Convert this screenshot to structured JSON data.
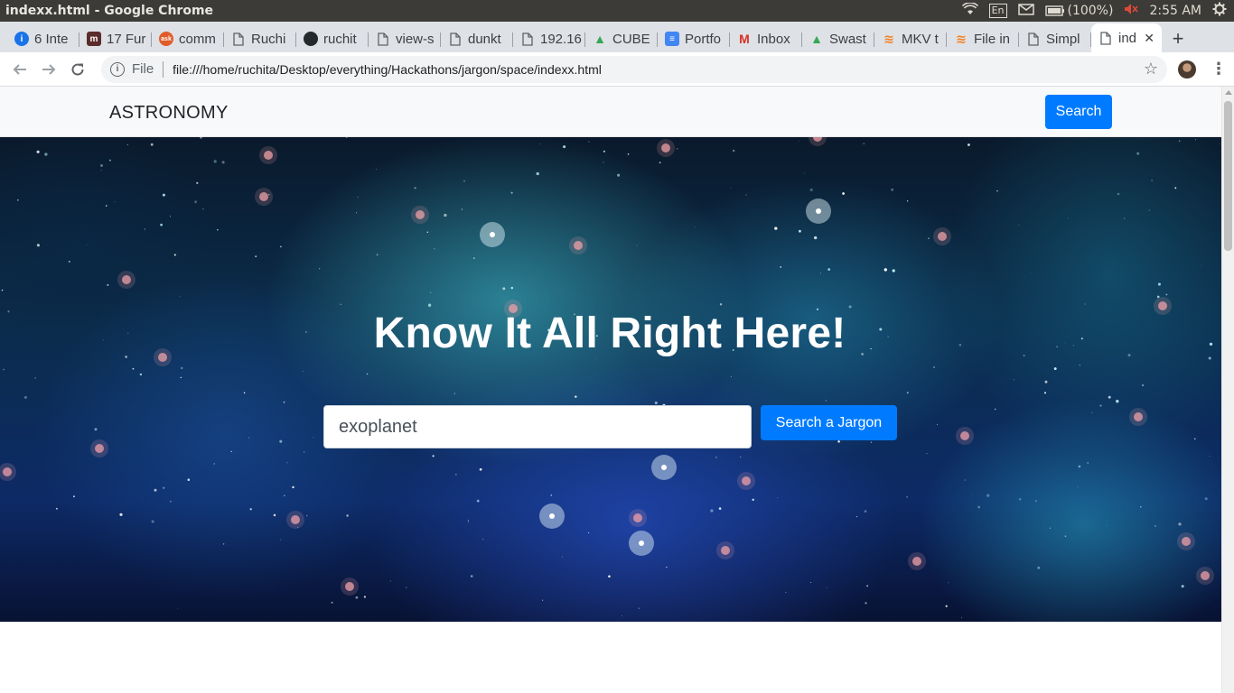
{
  "window": {
    "title": "indexx.html - Google Chrome",
    "tray": {
      "keyboard": "En",
      "battery": "(100%)",
      "clock": "2:55 AM"
    }
  },
  "tabs": [
    {
      "label": "6 Inte",
      "icon": "info-tab-icon",
      "color": "#1a73e8"
    },
    {
      "label": "17 Fur",
      "icon": "m-logo-icon",
      "color": "#5b2c2c"
    },
    {
      "label": "comm",
      "icon": "ask-logo-icon",
      "color": "#e05d2b"
    },
    {
      "label": "Ruchi",
      "icon": "page-icon",
      "color": "#5f6368"
    },
    {
      "label": "ruchit",
      "icon": "github-icon",
      "color": "#24292e"
    },
    {
      "label": "view-s",
      "icon": "page-icon",
      "color": "#5f6368"
    },
    {
      "label": "dunkt",
      "icon": "page-icon",
      "color": "#5f6368"
    },
    {
      "label": "192.16",
      "icon": "page-icon",
      "color": "#5f6368"
    },
    {
      "label": "CUBE",
      "icon": "drive-icon",
      "color": "#34a853"
    },
    {
      "label": "Portfo",
      "icon": "docs-icon",
      "color": "#4285f4"
    },
    {
      "label": "Inbox",
      "icon": "gmail-icon",
      "color": "#d93025"
    },
    {
      "label": "Swast",
      "icon": "drive-icon",
      "color": "#34a853"
    },
    {
      "label": "MKV t",
      "icon": "stack-icon",
      "color": "#f48024"
    },
    {
      "label": "File in",
      "icon": "stack-icon",
      "color": "#f48024"
    },
    {
      "label": "Simpl",
      "icon": "page-icon",
      "color": "#5f6368"
    },
    {
      "label": "ind",
      "icon": "page-icon",
      "color": "#5f6368",
      "active": true
    }
  ],
  "omnibox": {
    "scheme": "File",
    "url": "file:///home/ruchita/Desktop/everything/Hackathons/jargon/space/indexx.html"
  },
  "page": {
    "brand": "ASTRONOMY",
    "nav_search_label": "Search",
    "hero_title": "Know It All Right Here!",
    "search_value": "exoplanet",
    "search_button_label": "Search a Jargon"
  },
  "colors": {
    "primary_button": "#007bff",
    "navbar_bg": "#f8f9fa"
  }
}
